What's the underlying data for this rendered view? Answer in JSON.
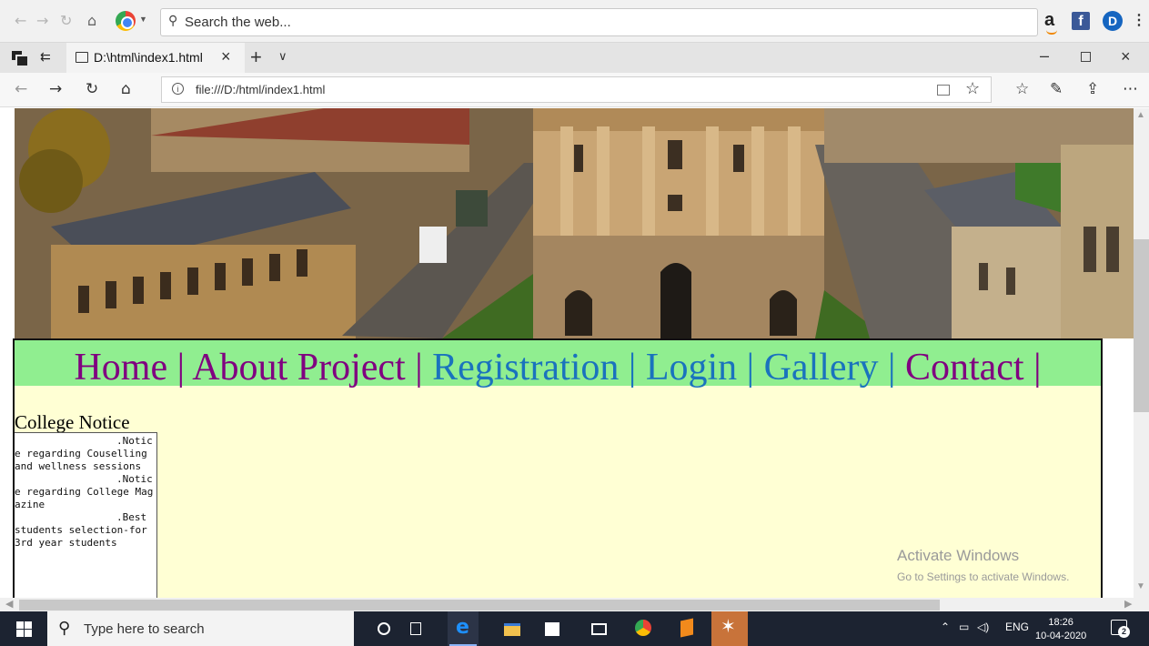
{
  "outer_browser": {
    "search_placeholder": "Search the web...",
    "icons": [
      "back-icon",
      "forward-icon",
      "refresh-icon",
      "home-icon",
      "chrome-logo",
      "amazon-extension-icon",
      "facebook-extension-icon",
      "d-extension-icon",
      "kebab-menu-icon"
    ],
    "ext_amazon": "a",
    "ext_facebook": "f",
    "ext_d": "D",
    "menu": "⋮"
  },
  "tab": {
    "title": "D:\\html\\index1.html"
  },
  "address_bar": {
    "url": "file:///D:/html/index1.html"
  },
  "page": {
    "nav": [
      {
        "label": "Home",
        "state": "visited"
      },
      {
        "label": "About Project",
        "state": "visited"
      },
      {
        "label": "Registration",
        "state": "fresh"
      },
      {
        "label": "Login",
        "state": "fresh"
      },
      {
        "label": "Gallery",
        "state": "fresh"
      },
      {
        "label": "Contact",
        "state": "visited"
      }
    ],
    "separator": "|",
    "notice_title": "College Notice",
    "notices": [
      ".Notice regarding Couselling and wellness sessions",
      ".Notice regarding College Magazine",
      ".Best students selection-for 3rd year students"
    ],
    "colors": {
      "nav_band": "#90ee90",
      "content_bg": "#ffffd4",
      "visited_link": "#800080",
      "unvisited_link": "#1a73bd"
    }
  },
  "watermark": {
    "line1": "Activate Windows",
    "line2": "Go to Settings to activate Windows."
  },
  "taskbar": {
    "search_placeholder": "Type here to search",
    "lang": "ENG",
    "time": "18:26",
    "date": "10-04-2020",
    "notifications": "2"
  }
}
